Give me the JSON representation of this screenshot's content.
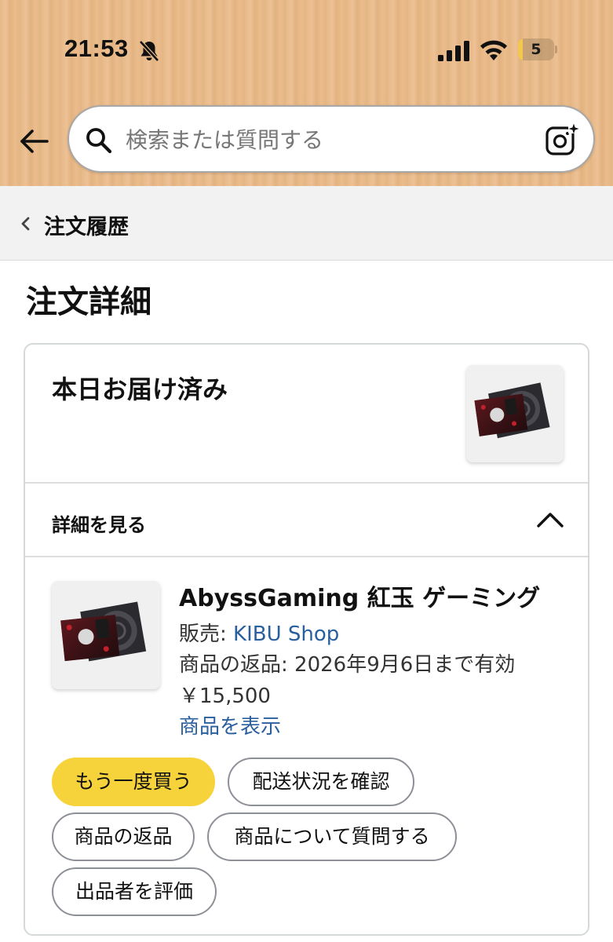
{
  "status_bar": {
    "time": "21:53",
    "battery_level": "5",
    "battery_fraction": 0.12
  },
  "search": {
    "placeholder": "検索または質問する"
  },
  "breadcrumb": {
    "label": "注文履歴"
  },
  "page": {
    "title": "注文詳細"
  },
  "order": {
    "delivery_status": "本日お届け済み",
    "details_toggle_label": "詳細を見る",
    "item": {
      "title": "AbyssGaming 紅玉 ゲーミング",
      "seller_prefix": "販売: ",
      "seller_name": "KIBU Shop",
      "return_policy": "商品の返品: 2026年9月6日まで有効",
      "price": "￥15,500",
      "view_item_link": "商品を表示"
    },
    "actions": {
      "buy_again": "もう一度買う",
      "track_package": "配送状況を確認",
      "return_item": "商品の返品",
      "ask_question": "商品について質問する",
      "rate_seller": "出品者を評価"
    }
  },
  "colors": {
    "primary_button": "#f7d33b",
    "link": "#2a5f9e"
  }
}
